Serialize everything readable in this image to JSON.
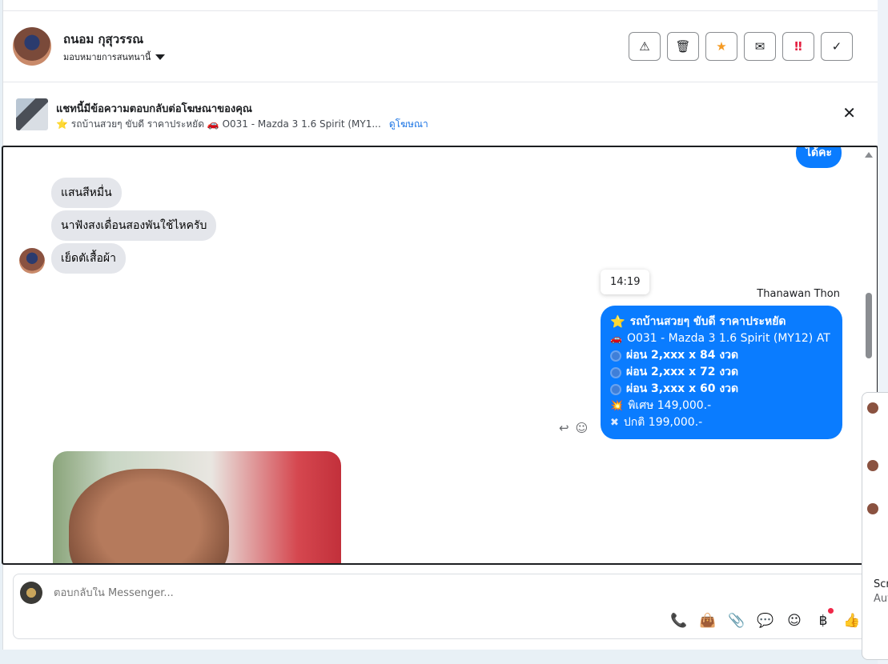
{
  "header": {
    "contact_name": "ถนอม กุสุวรรณ",
    "assign_label": "มอบหมายการสนทนานี้",
    "tools": [
      {
        "icon": "warning-icon",
        "glyph": "⚠"
      },
      {
        "icon": "trash-icon",
        "glyph": "🗑"
      },
      {
        "icon": "star-icon",
        "glyph": "★"
      },
      {
        "icon": "mail-open-icon",
        "glyph": "✉"
      },
      {
        "icon": "urgent-icon",
        "glyph": "‼"
      },
      {
        "icon": "check-icon",
        "glyph": "✓"
      }
    ]
  },
  "banner": {
    "title": "แชทนี้มีข้อความตอบกลับต่อโฆษณาของคุณ",
    "subtitle": "⭐ รถบ้านสวยๆ ขับดี ราคาประหยัด 🚗 O031 - Mazda 3 1.6 Spirit (MY1...",
    "link": "ดูโฆษณา",
    "close": "✕"
  },
  "thread": {
    "top_partial_out": "ได้คะ",
    "incoming": [
      "แสนสีหมื่น",
      "นาฟังสงเดื่อนสองพันใช้ไหครับ",
      "เย็ดตัเสื้อผ้า"
    ],
    "timestamp": "14:19",
    "sender": "Thanawan Thon",
    "ad_message": {
      "lines": [
        {
          "icon": "star",
          "glyph": "⭐",
          "text": "รถบ้านสวยๆ ขับดี ราคาประหยัด",
          "bold": true
        },
        {
          "icon": "car",
          "glyph": "🚗",
          "text": "O031 - Mazda 3 1.6 Spirit (MY12) AT",
          "bold": false
        },
        {
          "icon": "circle",
          "glyph": "",
          "text": "ผ่อน 2,xxx x 84 งวด",
          "bold": true
        },
        {
          "icon": "circle",
          "glyph": "",
          "text": "ผ่อน 2,xxx x 72 งวด",
          "bold": true
        },
        {
          "icon": "circle",
          "glyph": "",
          "text": "ผ่อน 3,xxx x 60 งวด",
          "bold": true
        },
        {
          "icon": "burst",
          "glyph": "💥",
          "text": "พิเศษ 149,000.-",
          "bold": false
        },
        {
          "icon": "tag",
          "glyph": "✖",
          "text": "ปกติ 199,000.-",
          "bold": false
        }
      ]
    },
    "reply_icon": "↩",
    "emoji_icon": "☺"
  },
  "composer": {
    "placeholder": "ตอบกลับใน Messenger...",
    "icons": [
      {
        "name": "call-add-icon",
        "glyph": "📞"
      },
      {
        "name": "shopping-bag-icon",
        "glyph": "👜"
      },
      {
        "name": "attachment-icon",
        "glyph": "📎"
      },
      {
        "name": "chat-bubble-icon",
        "glyph": "💬"
      },
      {
        "name": "emoji-icon",
        "glyph": "☺"
      },
      {
        "name": "baht-icon",
        "glyph": "฿"
      },
      {
        "name": "thumbs-up-icon",
        "glyph": "👍"
      }
    ]
  },
  "side_panel": {
    "line1": "Scr",
    "line2": "Aut"
  },
  "colors": {
    "accent": "#0a7cff",
    "link": "#1b74e4",
    "incoming_bubble": "#e4e6eb",
    "star": "#f59a23",
    "urgent": "#e41e3f"
  }
}
